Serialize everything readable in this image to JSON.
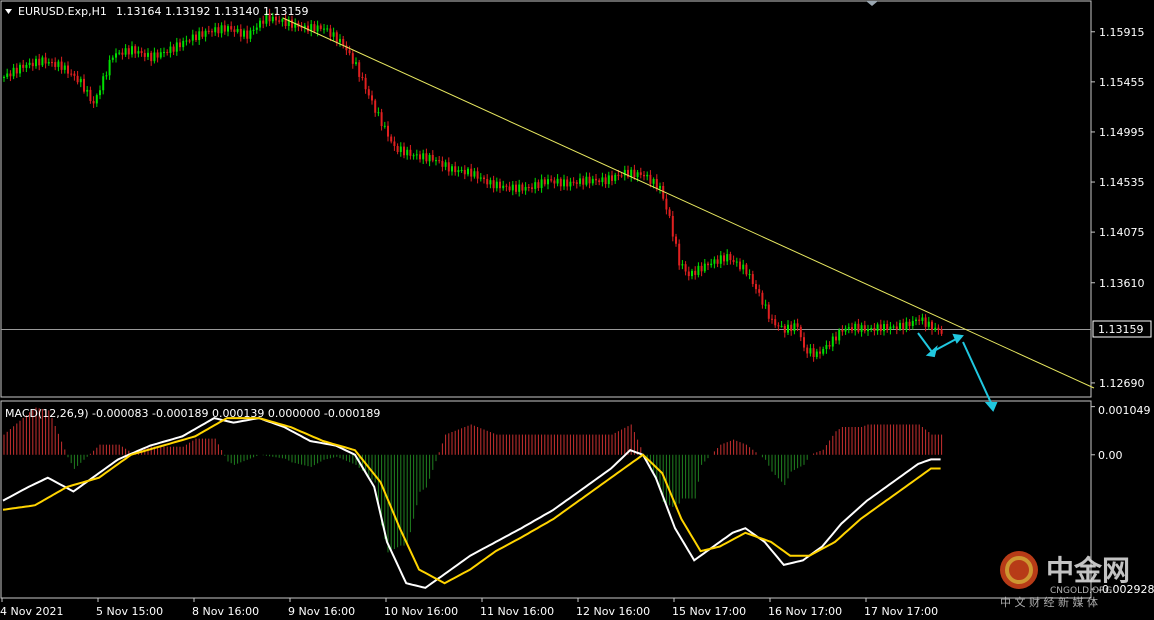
{
  "chart_data": {
    "type": "candlestick",
    "symbol_header": "EURUSD.Exp,H1",
    "ohlc": [
      "1.13164",
      "1.13192",
      "1.13140",
      "1.13159"
    ],
    "current_price_label": "1.13159",
    "current_price": 1.13159,
    "price_axis_labels": [
      "1.15915",
      "1.15455",
      "1.14995",
      "1.14535",
      "1.14075",
      "1.13610",
      "1.12690"
    ],
    "price_axis_values": [
      1.15915,
      1.15455,
      1.14995,
      1.14535,
      1.14075,
      1.1361,
      1.1269
    ],
    "price_range": [
      1.1257,
      1.1617
    ],
    "time_labels": [
      "4 Nov 2021",
      "5 Nov 15:00",
      "8 Nov 16:00",
      "9 Nov 16:00",
      "10 Nov 16:00",
      "11 Nov 16:00",
      "12 Nov 16:00",
      "15 Nov 17:00",
      "16 Nov 17:00",
      "17 Nov 17:00"
    ],
    "close_path": [
      [
        0,
        1.155
      ],
      [
        6,
        1.156
      ],
      [
        12,
        1.1565
      ],
      [
        18,
        1.156
      ],
      [
        24,
        1.1545
      ],
      [
        28,
        1.1525
      ],
      [
        30,
        1.154
      ],
      [
        34,
        1.157
      ],
      [
        40,
        1.1575
      ],
      [
        46,
        1.1568
      ],
      [
        52,
        1.1575
      ],
      [
        58,
        1.1585
      ],
      [
        64,
        1.1592
      ],
      [
        70,
        1.1595
      ],
      [
        76,
        1.1588
      ],
      [
        82,
        1.1605
      ],
      [
        88,
        1.16
      ],
      [
        94,
        1.1595
      ],
      [
        100,
        1.1595
      ],
      [
        106,
        1.158
      ],
      [
        110,
        1.156
      ],
      [
        116,
        1.152
      ],
      [
        122,
        1.1485
      ],
      [
        128,
        1.1478
      ],
      [
        134,
        1.1475
      ],
      [
        140,
        1.1465
      ],
      [
        146,
        1.1462
      ],
      [
        152,
        1.1452
      ],
      [
        158,
        1.1448
      ],
      [
        164,
        1.1448
      ],
      [
        170,
        1.1455
      ],
      [
        176,
        1.1452
      ],
      [
        182,
        1.1455
      ],
      [
        188,
        1.1455
      ],
      [
        194,
        1.1462
      ],
      [
        200,
        1.146
      ],
      [
        205,
        1.1448
      ],
      [
        208,
        1.142
      ],
      [
        211,
        1.138
      ],
      [
        214,
        1.1368
      ],
      [
        220,
        1.1378
      ],
      [
        226,
        1.1385
      ],
      [
        232,
        1.1372
      ],
      [
        236,
        1.135
      ],
      [
        240,
        1.1325
      ],
      [
        244,
        1.1318
      ],
      [
        248,
        1.1322
      ],
      [
        250,
        1.13
      ],
      [
        254,
        1.1295
      ],
      [
        258,
        1.1305
      ],
      [
        262,
        1.1318
      ],
      [
        266,
        1.132
      ],
      [
        270,
        1.1318
      ],
      [
        274,
        1.132
      ],
      [
        278,
        1.132
      ],
      [
        282,
        1.1322
      ],
      [
        286,
        1.1328
      ],
      [
        290,
        1.132
      ],
      [
        293,
        1.1316
      ]
    ],
    "trendline_value_label": "",
    "forecast_arrows_description": "",
    "macd": {
      "label": "MACD(12,26,9) -0.000083 -0.000189 0.000139 0.000000 -0.000189",
      "axis_labels": [
        "0.001049",
        "0.00",
        "-0.002928"
      ],
      "axis_values": [
        0.001049,
        0.0,
        -0.002928
      ],
      "range": [
        -0.0031,
        0.00115
      ],
      "main_line": [
        [
          0,
          -0.001
        ],
        [
          8,
          -0.0007
        ],
        [
          14,
          -0.0005
        ],
        [
          22,
          -0.0008
        ],
        [
          28,
          -0.0005
        ],
        [
          36,
          -0.0001
        ],
        [
          46,
          0.0002
        ],
        [
          56,
          0.0004
        ],
        [
          66,
          0.0008
        ],
        [
          72,
          0.0007
        ],
        [
          80,
          0.0008
        ],
        [
          88,
          0.0006
        ],
        [
          96,
          0.0003
        ],
        [
          104,
          0.0002
        ],
        [
          110,
          0.0
        ],
        [
          116,
          -0.0007
        ],
        [
          120,
          -0.0019
        ],
        [
          126,
          -0.0028
        ],
        [
          132,
          -0.0029
        ],
        [
          138,
          -0.0026
        ],
        [
          146,
          -0.0022
        ],
        [
          154,
          -0.0019
        ],
        [
          162,
          -0.0016
        ],
        [
          172,
          -0.0012
        ],
        [
          182,
          -0.0007
        ],
        [
          190,
          -0.0003
        ],
        [
          196,
          0.0001
        ],
        [
          200,
          0.0
        ],
        [
          204,
          -0.0005
        ],
        [
          210,
          -0.0016
        ],
        [
          216,
          -0.0023
        ],
        [
          222,
          -0.002
        ],
        [
          228,
          -0.0017
        ],
        [
          232,
          -0.0016
        ],
        [
          238,
          -0.0019
        ],
        [
          244,
          -0.0024
        ],
        [
          250,
          -0.0023
        ],
        [
          256,
          -0.002
        ],
        [
          262,
          -0.0015
        ],
        [
          270,
          -0.001
        ],
        [
          278,
          -0.0006
        ],
        [
          286,
          -0.0002
        ],
        [
          290,
          -0.0001
        ]
      ],
      "signal_line": [
        [
          0,
          -0.0012
        ],
        [
          10,
          -0.0011
        ],
        [
          20,
          -0.0007
        ],
        [
          30,
          -0.0005
        ],
        [
          40,
          0.0
        ],
        [
          50,
          0.0002
        ],
        [
          60,
          0.0004
        ],
        [
          70,
          0.0008
        ],
        [
          80,
          0.0008
        ],
        [
          90,
          0.0006
        ],
        [
          100,
          0.0003
        ],
        [
          110,
          0.0001
        ],
        [
          118,
          -0.0006
        ],
        [
          124,
          -0.0016
        ],
        [
          130,
          -0.0025
        ],
        [
          138,
          -0.0028
        ],
        [
          146,
          -0.0025
        ],
        [
          154,
          -0.0021
        ],
        [
          162,
          -0.0018
        ],
        [
          172,
          -0.0014
        ],
        [
          182,
          -0.0009
        ],
        [
          192,
          -0.0004
        ],
        [
          200,
          0.0
        ],
        [
          206,
          -0.0004
        ],
        [
          212,
          -0.0014
        ],
        [
          218,
          -0.0021
        ],
        [
          224,
          -0.002
        ],
        [
          232,
          -0.0017
        ],
        [
          240,
          -0.0019
        ],
        [
          246,
          -0.0022
        ],
        [
          252,
          -0.0022
        ],
        [
          260,
          -0.0019
        ],
        [
          268,
          -0.0014
        ],
        [
          276,
          -0.001
        ],
        [
          284,
          -0.0006
        ],
        [
          290,
          -0.0003
        ]
      ]
    },
    "colors": {
      "background": "#000000",
      "bull": "#00e000",
      "bear": "#e02020",
      "trendline": "#e8e860",
      "arrow": "#20c8e0",
      "macd_main": "#ffffff",
      "macd_signal": "#ffd400",
      "hist_pos": "#c83030",
      "hist_neg": "#208020",
      "grid_line": "#c8c8c8"
    }
  },
  "watermark": {
    "brand_cn": "中金网",
    "brand_en": "CNGOLD.ORG",
    "tagline": "中 文 财 经 新 媒 体"
  }
}
